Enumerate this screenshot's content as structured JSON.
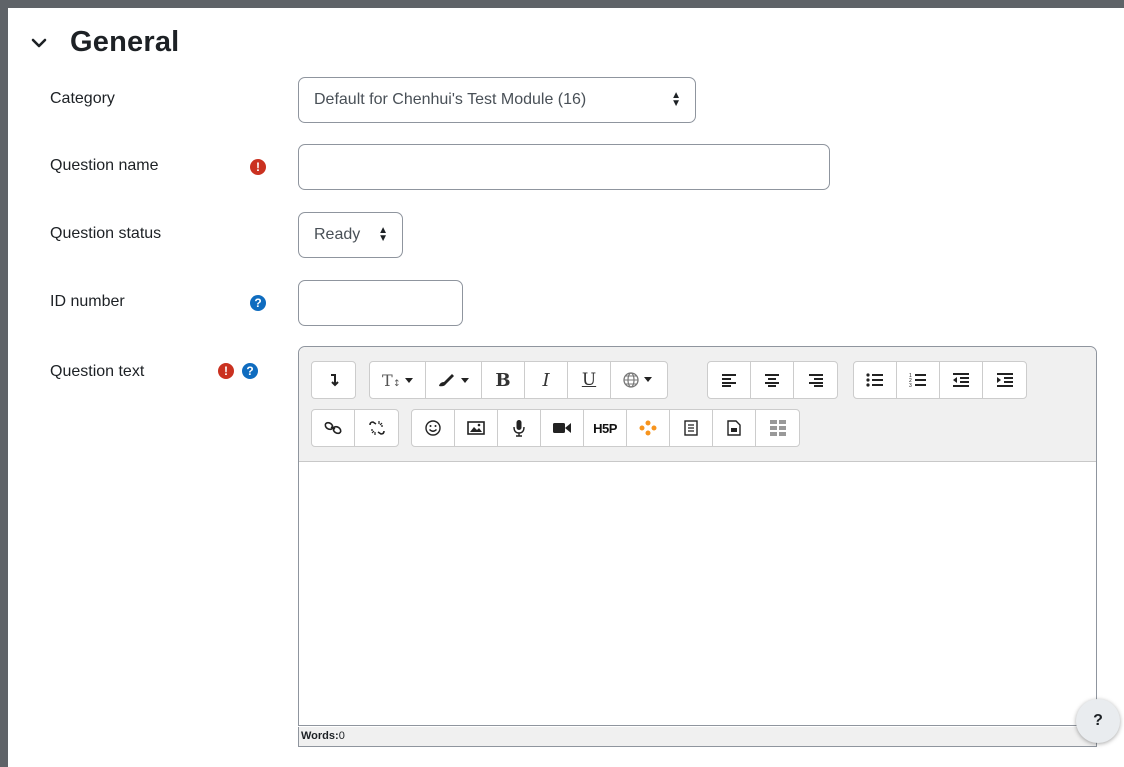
{
  "section": {
    "title": "General",
    "expanded": true
  },
  "fields": {
    "category": {
      "label": "Category",
      "value": "Default for Chenhui's Test Module (16)"
    },
    "question_name": {
      "label": "Question name",
      "value": "",
      "required": true
    },
    "question_status": {
      "label": "Question status",
      "value": "Ready"
    },
    "id_number": {
      "label": "ID number",
      "value": "",
      "has_help": true
    },
    "question_text": {
      "label": "Question text",
      "required": true,
      "has_help": true,
      "value": ""
    }
  },
  "editor": {
    "toolbar_row1": [
      [
        "collapse-toolbar-icon"
      ],
      [
        "font-size-icon",
        "text-color-icon",
        "bold-icon",
        "italic-icon",
        "underline-icon",
        "language-icon"
      ],
      [
        "align-left-icon",
        "align-center-icon",
        "align-right-icon"
      ],
      [
        "bullet-list-icon",
        "numbered-list-icon",
        "outdent-icon",
        "indent-icon"
      ]
    ],
    "toolbar_row2": [
      [
        "link-icon",
        "unlink-icon"
      ],
      [
        "emoji-icon",
        "image-icon",
        "record-audio-icon",
        "record-video-icon",
        "h5p-icon",
        "dots-icon",
        "template-icon",
        "media-file-icon",
        "table-icon"
      ]
    ],
    "bold_label": "B",
    "italic_label": "I",
    "underline_label": "U",
    "h5p_label": "H5P",
    "words_label": "Words:",
    "words_count": "0"
  },
  "colors": {
    "required_icon": "#ca3120",
    "help_icon": "#0f6cbf",
    "toolbar_bg": "#f0f0f0"
  },
  "help_button": {
    "label": "?"
  }
}
